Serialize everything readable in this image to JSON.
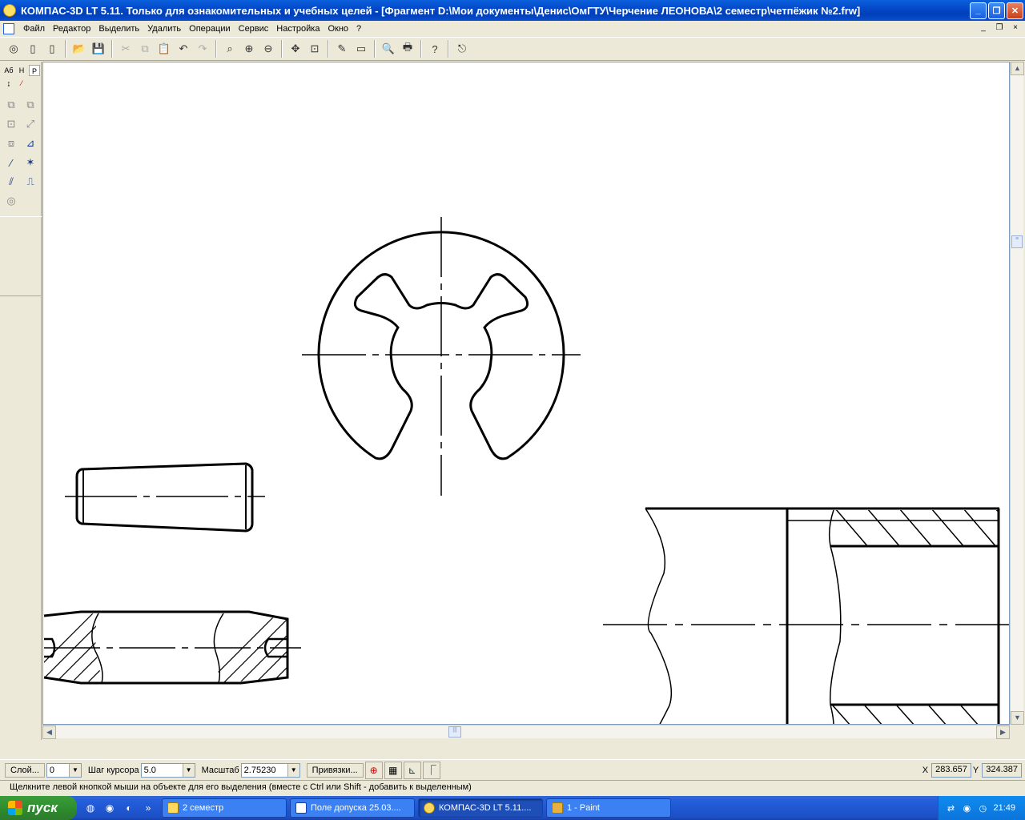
{
  "window": {
    "title": "КОМПАС-3D LT 5.11. Только для ознакомительных и учебных целей - [Фрагмент D:\\Мои документы\\Денис\\ОмГТУ\\Черчение  ЛЕОНОВА\\2 семестр\\четпёжик №2.frw]",
    "min": "_",
    "max": "❐",
    "close": "✕"
  },
  "menu": {
    "items": [
      "Файл",
      "Редактор",
      "Выделить",
      "Удалить",
      "Операции",
      "Сервис",
      "Настройка",
      "Окно",
      "?"
    ],
    "mdi_min": "_",
    "mdi_restore": "❐",
    "mdi_close": "×"
  },
  "toolbar": {
    "icons": [
      "manager-icon",
      "new-sheet-icon",
      "new-fragment-icon",
      "open-icon",
      "save-icon",
      "cut-icon",
      "copy-icon",
      "paste-icon",
      "undo-icon",
      "redo-icon",
      "zoom-window-icon",
      "zoom-in-icon",
      "zoom-out-icon",
      "pan-icon",
      "zoom-all-icon",
      "redraw-icon",
      "preview-icon",
      "print-preview-icon",
      "print-icon",
      "help-icon",
      "exit-icon"
    ],
    "glyphs": [
      "◎",
      "▯",
      "▯",
      "📂",
      "💾",
      "✂",
      "⧉",
      "📋",
      "↶",
      "↷",
      "⌕",
      "⊕",
      "⊖",
      "✥",
      "⊡",
      "✎",
      "▭",
      "🔍",
      "🖶",
      "?",
      "⎋"
    ]
  },
  "leftpanel": {
    "tabs": [
      "Аб",
      "Н",
      "Р",
      "↨",
      "⁄"
    ],
    "glyphs": [
      "⧉",
      "⧉",
      "⊡",
      "⤢",
      "⧈",
      "⊿",
      "⁄",
      "✶",
      "⫽",
      "⎍",
      "◎"
    ]
  },
  "parambar": {
    "layer_btn": "Слой...",
    "layer_value": "0",
    "step_label": "Шаг курсора",
    "step_value": "5.0",
    "scale_label": "Масштаб",
    "scale_value": "2.75230",
    "snaps_btn": "Привязки...",
    "x_label": "X",
    "x_value": "283.657",
    "y_label": "Y",
    "y_value": "324.387"
  },
  "hint": "Щелкните левой кнопкой мыши на объекте для его выделения (вместе с Ctrl или Shift - добавить к выделенным)",
  "taskbar": {
    "start": "пуск",
    "more": "»",
    "tasks": [
      {
        "label": "2 семестр",
        "active": false
      },
      {
        "label": "Поле допуска 25.03....",
        "active": false
      },
      {
        "label": "КОМПАС-3D LT 5.11....",
        "active": true
      },
      {
        "label": "1 - Paint",
        "active": false
      }
    ],
    "clock": "21:49"
  },
  "colors": {
    "title_blue": "#0449c8",
    "canvas": "#ffffff",
    "line": "#000000"
  }
}
